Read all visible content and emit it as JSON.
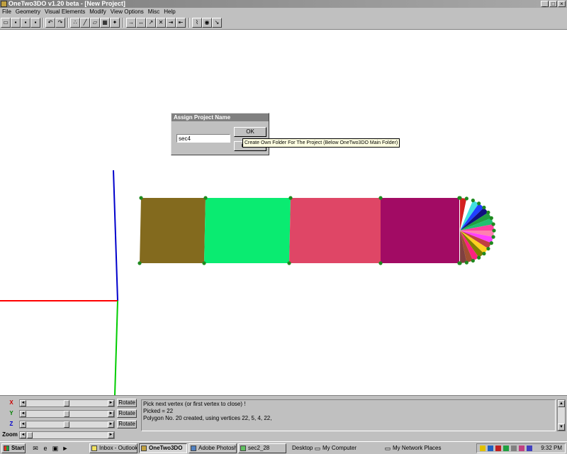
{
  "window": {
    "title": "OneTwo3DO  v1.20 beta - [New Project]"
  },
  "menu": [
    "File",
    "Geometry",
    "Visual Elements",
    "Modify",
    "View Options",
    "Misc",
    "Help"
  ],
  "dialog": {
    "title": "Assign Project Name",
    "input_value": "sec4",
    "ok_label": "OK",
    "cancel_label": "Cancel",
    "tooltip": "Create Own Folder For The Project (Below OneTwo3DO Main Folder)"
  },
  "scene": {
    "axis_colors": {
      "x": "#ff0000",
      "y": "#00cc00",
      "z": "#0000cc"
    },
    "vertex_color": "#1f8a1f",
    "polygons": [
      {
        "color": "#836a1e"
      },
      {
        "color": "#0aeb71"
      },
      {
        "color": "#df4666"
      },
      {
        "color": "#a20b64"
      }
    ],
    "fan_colors": [
      "#d42020",
      "#ffffff",
      "#40e0e0",
      "#2040ff",
      "#101080",
      "#20a040",
      "#20c070",
      "#ff40a0",
      "#ff80b0",
      "#ff40ff",
      "#c04040",
      "#ffd020",
      "#808000",
      "#ff2080",
      "#a05030",
      "#804040"
    ]
  },
  "controls": {
    "rows": [
      {
        "axis": "X",
        "color": "#cc0000",
        "button": "Rotate"
      },
      {
        "axis": "Y",
        "color": "#008000",
        "button": "Rotate"
      },
      {
        "axis": "Z",
        "color": "#0000cc",
        "button": "Rotate"
      },
      {
        "axis": "Zoom",
        "color": "#000000",
        "button": ""
      }
    ]
  },
  "log": {
    "lines": [
      "Pick next vertex (or first vertex to close) !",
      "Picked = 22",
      "Polygon No. 20 created, using vertices 22, 5, 4, 22,"
    ]
  },
  "taskbar": {
    "start": "Start",
    "buttons": [
      "Inbox - Outlook...",
      "OneTwo3DO",
      "Adobe Photosh...",
      "sec2_28"
    ],
    "desktop": "Desktop",
    "my_computer": "My Computer",
    "network": "My Network Places",
    "clock": "9:32 PM"
  }
}
